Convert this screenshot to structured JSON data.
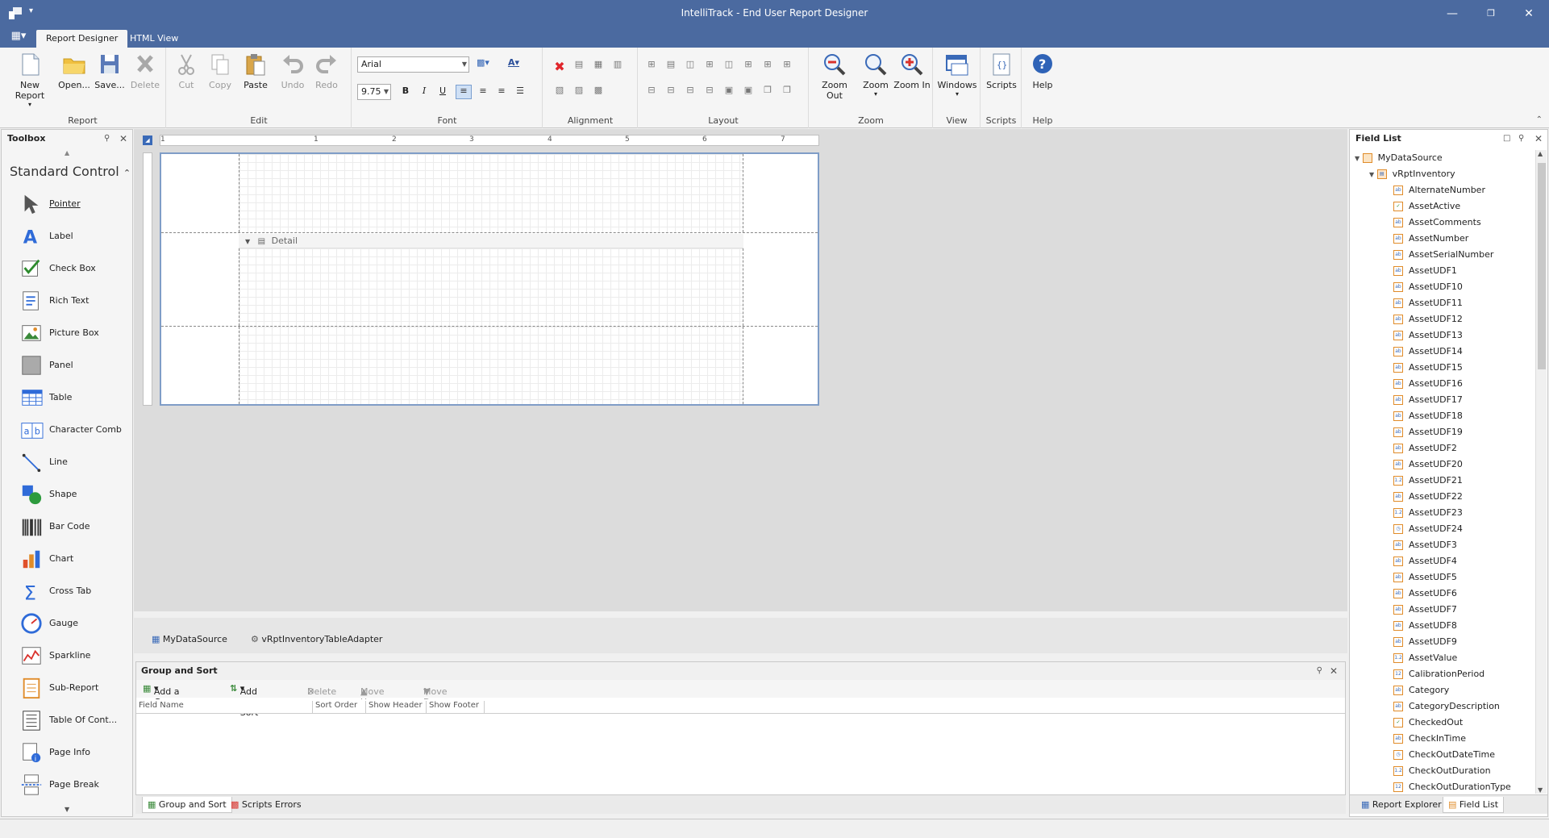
{
  "window": {
    "title": "IntelliTrack - End User Report Designer"
  },
  "ribbon_tabs": [
    "Report Designer",
    "HTML View"
  ],
  "ribbon": {
    "groups": {
      "report": "Report",
      "edit": "Edit",
      "font": "Font",
      "alignment": "Alignment",
      "layout": "Layout",
      "zoom": "Zoom",
      "view": "View",
      "scripts": "Scripts",
      "help": "Help"
    },
    "buttons": {
      "new_report": "New Report",
      "open": "Open...",
      "save": "Save...",
      "delete": "Delete",
      "cut": "Cut",
      "copy": "Copy",
      "paste": "Paste",
      "undo": "Undo",
      "redo": "Redo",
      "zoom_out": "Zoom Out",
      "zoom": "Zoom",
      "zoom_in": "Zoom In",
      "windows": "Windows",
      "scripts": "Scripts",
      "help": "Help"
    },
    "font_name": "Arial",
    "font_size": "9.75",
    "bold": "B",
    "italic": "I",
    "underline": "U"
  },
  "toolbox": {
    "title": "Toolbox",
    "category": "Standard Control",
    "items": [
      "Pointer",
      "Label",
      "Check Box",
      "Rich Text",
      "Picture Box",
      "Panel",
      "Table",
      "Character Comb",
      "Line",
      "Shape",
      "Bar Code",
      "Chart",
      "Cross Tab",
      "Gauge",
      "Sparkline",
      "Sub-Report",
      "Table Of Cont...",
      "Page Info",
      "Page Break"
    ]
  },
  "designer": {
    "ruler_labels": [
      "1",
      "1",
      "2",
      "3",
      "4",
      "5",
      "6",
      "7"
    ],
    "detail_band": "Detail"
  },
  "component_tray": {
    "items": [
      "MyDataSource",
      "vRptInventoryTableAdapter"
    ]
  },
  "group_and_sort": {
    "title": "Group and Sort",
    "toolbar": {
      "add_group": "Add a Group",
      "add_sort": "Add a Sort",
      "delete": "Delete",
      "move_up": "Move Up",
      "move_down": "Move Down"
    },
    "columns": [
      "Field Name",
      "Sort Order",
      "Show Header",
      "Show Footer"
    ]
  },
  "bottom_tabs": [
    "Group and Sort",
    "Scripts Errors"
  ],
  "field_list": {
    "title": "Field List",
    "datasource": "MyDataSource",
    "table": "vRptInventory",
    "fields": [
      {
        "name": "AlternateNumber",
        "type": "ab"
      },
      {
        "name": "AssetActive",
        "type": "check"
      },
      {
        "name": "AssetComments",
        "type": "ab"
      },
      {
        "name": "AssetNumber",
        "type": "ab"
      },
      {
        "name": "AssetSerialNumber",
        "type": "ab"
      },
      {
        "name": "AssetUDF1",
        "type": "ab"
      },
      {
        "name": "AssetUDF10",
        "type": "ab"
      },
      {
        "name": "AssetUDF11",
        "type": "ab"
      },
      {
        "name": "AssetUDF12",
        "type": "ab"
      },
      {
        "name": "AssetUDF13",
        "type": "ab"
      },
      {
        "name": "AssetUDF14",
        "type": "ab"
      },
      {
        "name": "AssetUDF15",
        "type": "ab"
      },
      {
        "name": "AssetUDF16",
        "type": "ab"
      },
      {
        "name": "AssetUDF17",
        "type": "ab"
      },
      {
        "name": "AssetUDF18",
        "type": "ab"
      },
      {
        "name": "AssetUDF19",
        "type": "ab"
      },
      {
        "name": "AssetUDF2",
        "type": "ab"
      },
      {
        "name": "AssetUDF20",
        "type": "ab"
      },
      {
        "name": "AssetUDF21",
        "type": "num"
      },
      {
        "name": "AssetUDF22",
        "type": "ab"
      },
      {
        "name": "AssetUDF23",
        "type": "num"
      },
      {
        "name": "AssetUDF24",
        "type": "clock"
      },
      {
        "name": "AssetUDF3",
        "type": "ab"
      },
      {
        "name": "AssetUDF4",
        "type": "ab"
      },
      {
        "name": "AssetUDF5",
        "type": "ab"
      },
      {
        "name": "AssetUDF6",
        "type": "ab"
      },
      {
        "name": "AssetUDF7",
        "type": "ab"
      },
      {
        "name": "AssetUDF8",
        "type": "ab"
      },
      {
        "name": "AssetUDF9",
        "type": "ab"
      },
      {
        "name": "AssetValue",
        "type": "num"
      },
      {
        "name": "CalibrationPeriod",
        "type": "int"
      },
      {
        "name": "Category",
        "type": "ab"
      },
      {
        "name": "CategoryDescription",
        "type": "ab"
      },
      {
        "name": "CheckedOut",
        "type": "check"
      },
      {
        "name": "CheckInTime",
        "type": "ab"
      },
      {
        "name": "CheckOutDateTime",
        "type": "clock"
      },
      {
        "name": "CheckOutDuration",
        "type": "num"
      },
      {
        "name": "CheckOutDurationType",
        "type": "int"
      }
    ]
  },
  "side_tabs": [
    "Report Explorer",
    "Field List"
  ]
}
